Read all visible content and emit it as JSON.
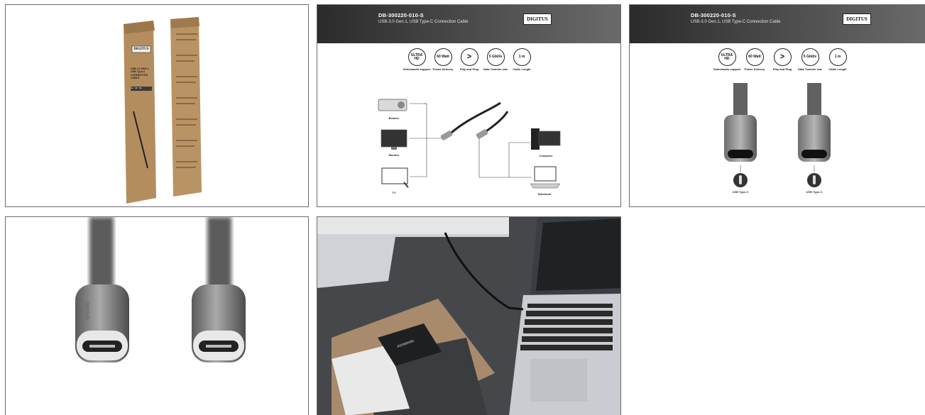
{
  "gallery": {
    "tile1": {
      "name": "product-packaging",
      "box_logo": "DIGITUS",
      "box_title": "USB 3.0 GEN.1, USB Type-C CONNECTION CABLE",
      "badges": [
        "1m",
        "4K",
        "5G"
      ]
    },
    "tile2": {
      "model": "DB-300220-010-S",
      "subtitle": "USB-3.0 Gen.1, USB Type-C Connection Cable",
      "logo": "DIGITUS",
      "features": [
        {
          "icon": "ULTRA HD",
          "label": "Video/audio support"
        },
        {
          "icon": "60 Watt",
          "label": "Power Delivery"
        },
        {
          "icon": ">",
          "label": "Play and Plug"
        },
        {
          "icon": "5 Gbit/s",
          "label": "Data Transfer rate"
        },
        {
          "icon": "1 m",
          "label": "Cable Length"
        }
      ],
      "devices": [
        "Beamer",
        "Monitor",
        "TV",
        "Computer",
        "Notebook"
      ]
    },
    "tile3": {
      "model": "DB-300220-010-S",
      "subtitle": "USB-3.0 Gen.1, USB Type-C Connection Cable",
      "logo": "DIGITUS",
      "features": [
        {
          "icon": "ULTRA HD",
          "label": "Video/audio support"
        },
        {
          "icon": "60 Watt",
          "label": "Power Delivery"
        },
        {
          "icon": ">",
          "label": "Play and Plug"
        },
        {
          "icon": "5 Gbit/s",
          "label": "Data Transfer rate"
        },
        {
          "icon": "1 m",
          "label": "Cable Length"
        }
      ],
      "connector_labels": [
        "USB Type-C",
        "USB Type-C"
      ]
    },
    "tile4": {
      "name": "connector-closeup",
      "brand_mark": "DIGITUS"
    },
    "tile5": {
      "name": "desk-lifestyle",
      "card_text": "ASSMANN"
    }
  },
  "colors": {
    "border": "#6b6b6b",
    "header_dark": "#2b2b2b",
    "kraft": "#b08a5e",
    "desk": "#3d3f42"
  }
}
